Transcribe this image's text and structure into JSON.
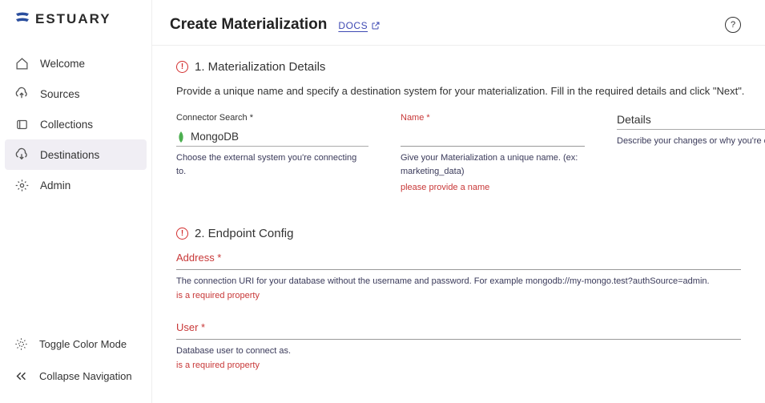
{
  "brand": "ESTUARY",
  "header": {
    "title": "Create Materialization",
    "docs_label": "DOCS"
  },
  "nav": {
    "items": [
      {
        "label": "Welcome",
        "icon": "home-icon"
      },
      {
        "label": "Sources",
        "icon": "cloud-upload-icon"
      },
      {
        "label": "Collections",
        "icon": "database-icon"
      },
      {
        "label": "Destinations",
        "icon": "cloud-download-icon"
      },
      {
        "label": "Admin",
        "icon": "gear-icon"
      }
    ]
  },
  "bottom": {
    "toggle": "Toggle Color Mode",
    "collapse": "Collapse Navigation"
  },
  "section1": {
    "title": "1. Materialization Details",
    "desc": "Provide a unique name and specify a destination system for your materialization. Fill in the required details and click \"Next\".",
    "connector": {
      "label": "Connector Search *",
      "value": "MongoDB",
      "help": "Choose the external system you're connecting to."
    },
    "name": {
      "label": "Name *",
      "help": "Give your Materialization a unique name. (ex: marketing_data)",
      "error": "please provide a name"
    },
    "details": {
      "label": "Details",
      "help": "Describe your changes or why you're cha"
    }
  },
  "section2": {
    "title": "2. Endpoint Config",
    "address": {
      "label": "Address *",
      "help": "The connection URI for your database without the username and password. For example mongodb://my-mongo.test?authSource=admin.",
      "error": "is a required property"
    },
    "user": {
      "label": "User *",
      "help": "Database user to connect as.",
      "error": "is a required property"
    }
  }
}
